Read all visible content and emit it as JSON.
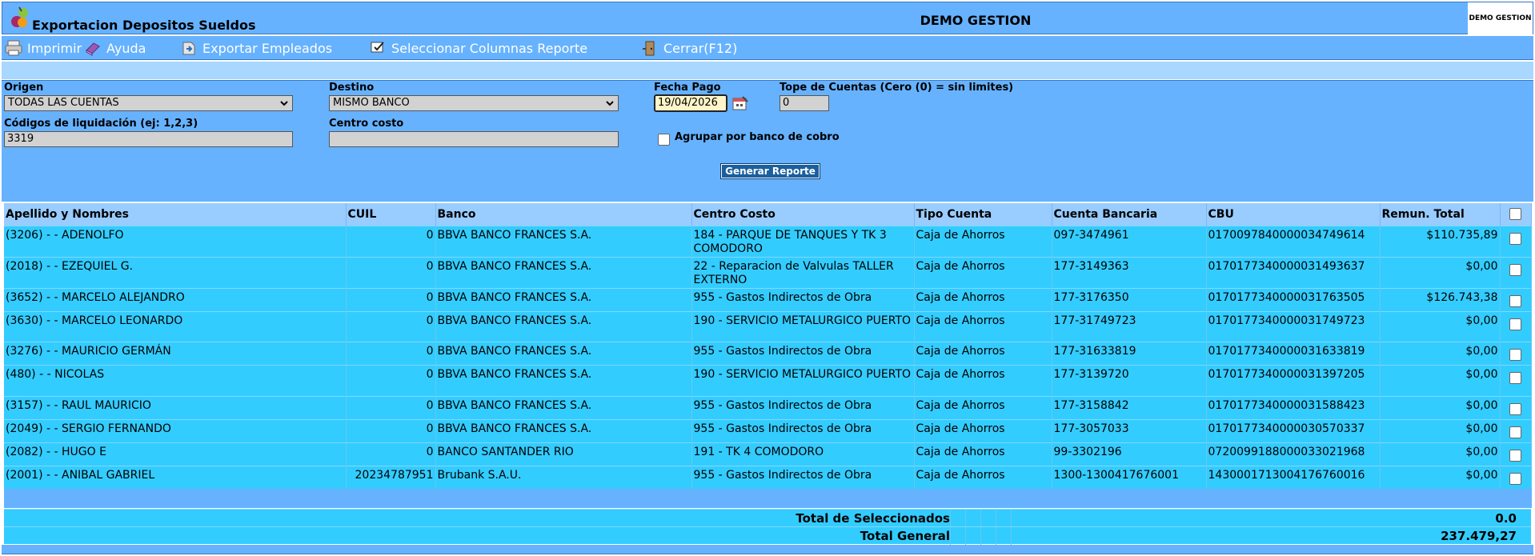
{
  "window": {
    "title": "Exportacion Depositos Sueldos",
    "company": "DEMO GESTION",
    "logo_text": "DEMO GESTION"
  },
  "toolbar": {
    "print": "Imprimir",
    "help": "Ayuda",
    "export_employees": "Exportar Empleados",
    "select_columns": "Seleccionar Columnas Reporte",
    "close": "Cerrar(F12)"
  },
  "filters": {
    "origin_label": "Origen",
    "origin_value": "TODAS LAS CUENTAS",
    "destination_label": "Destino",
    "destination_value": "MISMO BANCO",
    "date_label": "Fecha Pago",
    "date_value": "19/04/2026",
    "limit_label": "Tope de Cuentas (Cero (0) = sin limites)",
    "limit_value": "0",
    "codes_label": "Códigos de liquidación (ej: 1,2,3)",
    "codes_value": "3319",
    "cost_center_label": "Centro costo",
    "cost_center_value": "",
    "group_label": "Agrupar por banco de cobro",
    "generate_button": "Generar Reporte"
  },
  "table": {
    "columns": [
      "Apellido y Nombres",
      "CUIL",
      "Banco",
      "Centro Costo",
      "Tipo Cuenta",
      "Cuenta Bancaria",
      "CBU",
      "Remun. Total"
    ],
    "rows": [
      [
        "(3206) - - ADENOLFO",
        "0",
        "BBVA BANCO FRANCES S.A.",
        "184 - PARQUE DE TANQUES Y TK 3 COMODORO",
        "Caja de Ahorros",
        "097-3474961",
        "0170097840000034749614",
        "$110.735,89"
      ],
      [
        "(2018) - - EZEQUIEL G.",
        "0",
        "BBVA BANCO FRANCES S.A.",
        "22 - Reparacion de Valvulas TALLER EXTERNO",
        "Caja de Ahorros",
        "177-3149363",
        "0170177340000031493637",
        "$0,00"
      ],
      [
        "(3652) - - MARCELO ALEJANDRO",
        "0",
        "BBVA BANCO FRANCES S.A.",
        "955 - Gastos Indirectos de Obra",
        "Caja de Ahorros",
        "177-3176350",
        "0170177340000031763505",
        "$126.743,38"
      ],
      [
        "(3630) - - MARCELO LEONARDO",
        "0",
        "BBVA BANCO FRANCES S.A.",
        "190 - SERVICIO METALURGICO PUERTO",
        "Caja de Ahorros",
        "177-31749723",
        "0170177340000031749723",
        "$0,00"
      ],
      [
        "(3276) - - MAURICIO GERMÁN",
        "0",
        "BBVA BANCO FRANCES S.A.",
        "955 - Gastos Indirectos de Obra",
        "Caja de Ahorros",
        "177-31633819",
        "0170177340000031633819",
        "$0,00"
      ],
      [
        "(480) - - NICOLAS",
        "0",
        "BBVA BANCO FRANCES S.A.",
        "190 - SERVICIO METALURGICO PUERTO",
        "Caja de Ahorros",
        "177-3139720",
        "0170177340000031397205",
        "$0,00"
      ],
      [
        "(3157) - - RAUL MAURICIO",
        "0",
        "BBVA BANCO FRANCES S.A.",
        "955 - Gastos Indirectos de Obra",
        "Caja de Ahorros",
        "177-3158842",
        "0170177340000031588423",
        "$0,00"
      ],
      [
        "(2049) - - SERGIO FERNANDO",
        "0",
        "BBVA BANCO FRANCES S.A.",
        "955 - Gastos Indirectos de Obra",
        "Caja de Ahorros",
        "177-3057033",
        "0170177340000030570337",
        "$0,00"
      ],
      [
        "(2082) - - HUGO E",
        "0",
        "BANCO SANTANDER RIO",
        "191 - TK 4 COMODORO",
        "Caja de Ahorros",
        "99-3302196",
        "0720099188000033021968",
        "$0,00"
      ],
      [
        "(2001) - - ANIBAL GABRIEL",
        "20234787951",
        "Brubank S.A.U.",
        "955 - Gastos Indirectos de Obra",
        "Caja de Ahorros",
        "1300-1300417676001",
        "1430001713004176760016",
        "$0,00"
      ]
    ]
  },
  "totals": {
    "selected_label": "Total de Seleccionados",
    "selected_value": "0.0",
    "general_label": "Total General",
    "general_value": "237.479,27"
  },
  "colors": {
    "panel": "#66b2ff",
    "header": "#99ccff",
    "row": "#33ccff",
    "button": "#1a5f9e"
  }
}
